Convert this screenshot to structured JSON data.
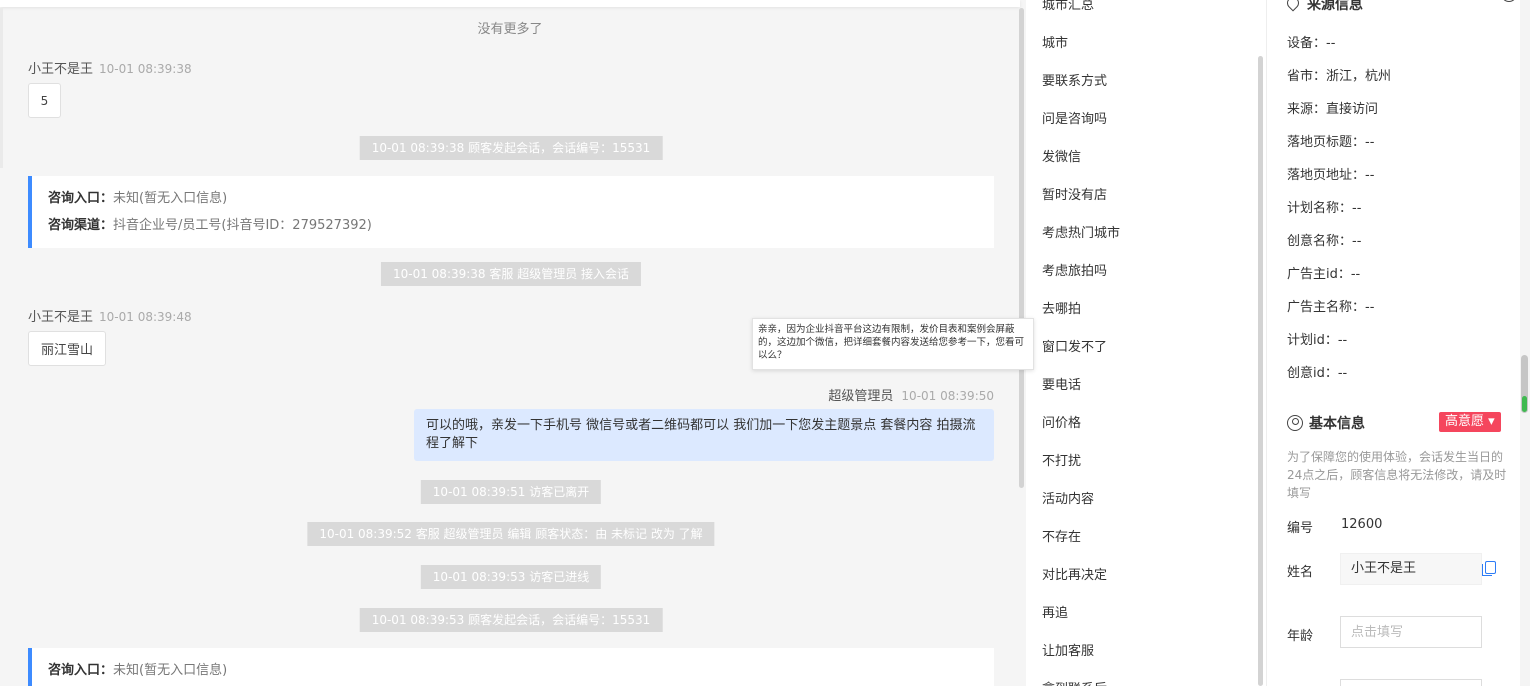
{
  "chat": {
    "no_more": "没有更多了",
    "messages": {
      "m1_sender": "小王不是王",
      "m1_time": "10-01 08:39:38",
      "m1_text": "5",
      "sys1": "10-01 08:39:38 顾客发起会话，会话编号：15531",
      "card1_entry_label": "咨询入口：",
      "card1_entry_value": "未知(暂无入口信息)",
      "card1_channel_label": "咨询渠道：",
      "card1_channel_value": "抖音企业号/员工号(抖音号ID：279527392)",
      "sys2": "10-01 08:39:38 客服 超级管理员 接入会话",
      "m2_sender": "小王不是王",
      "m2_time": "10-01 08:39:48",
      "m2_text": "丽江雪山",
      "agent_name": "超级管理员",
      "agent_time": "10-01 08:39:50",
      "agent_text": "可以的哦，亲发一下手机号 微信号或者二维码都可以 我们加一下您发主题景点 套餐内容 拍摄流程了解下",
      "sys3": "10-01 08:39:51 访客已离开",
      "sys4": "10-01 08:39:52 客服 超级管理员 编辑 顾客状态：由 未标记 改为 了解",
      "sys5": "10-01 08:39:53 访客已进线",
      "sys6": "10-01 08:39:53 顾客发起会话，会话编号：15531",
      "card2_entry_label": "咨询入口：",
      "card2_entry_value": "未知(暂无入口信息)"
    },
    "tooltip": "亲亲，因为企业抖音平台这边有限制，发价目表和案例会屏蔽的，这边加个微信，把详细套餐内容发送给您参考一下，您看可以么？"
  },
  "phrases": {
    "items": [
      "城市汇总",
      "城市",
      "要联系方式",
      "问是咨询吗",
      "发微信",
      "暂时没有店",
      "考虑热门城市",
      "考虑旅拍吗",
      "去哪拍",
      "窗口发不了",
      "要电话",
      "问价格",
      "不打扰",
      "活动内容",
      "不存在",
      "对比再决定",
      "再追",
      "让加客服",
      "拿到联系后"
    ]
  },
  "info": {
    "source_title": "来源信息",
    "source_fields": [
      "设备：--",
      "省市：浙江，杭州",
      "来源：直接访问",
      "落地页标题：--",
      "落地页地址：--",
      "计划名称：--",
      "创意名称：--",
      "广告主id：--",
      "广告主名称：--",
      "计划id：--",
      "创意id：--"
    ],
    "basic_title": "基本信息",
    "intent_badge": "高意愿 ▾",
    "note": "为了保障您的使用体验，会话发生当日的24点之后，顾客信息将无法修改，请及时填写",
    "id_label": "编号",
    "id_value": "12600",
    "name_label": "姓名",
    "name_value": "小王不是王",
    "age_label": "年龄",
    "age_placeholder": "点击填写"
  },
  "colors": {
    "accent": "#3d8bff",
    "agent_bubble": "#dce9ff",
    "system_pill": "#d9d9d9",
    "badge": "#f5465d"
  }
}
